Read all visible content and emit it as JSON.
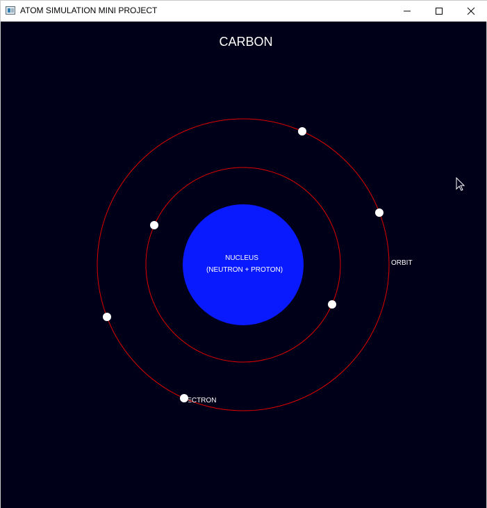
{
  "window": {
    "title": "ATOM SIMULATION MINI PROJECT",
    "controls": {
      "minimize_icon": "minimize-icon",
      "maximize_icon": "maximize-icon",
      "close_icon": "close-icon"
    }
  },
  "simulation": {
    "element_name": "CARBON",
    "nucleus_label": "NUCLEUS",
    "nucleus_sublabel": "(NEUTRON + PROTON)",
    "orbit_label": "ORBIT",
    "electron_label": "ELECTRON",
    "colors": {
      "background": "#000018",
      "nucleus": "#0a1aff",
      "orbit": "#e00000",
      "electron": "#ffffff",
      "text": "#ffffff"
    },
    "shells": [
      {
        "name": "inner",
        "electrons": 2
      },
      {
        "name": "outer",
        "electrons": 4
      }
    ]
  }
}
